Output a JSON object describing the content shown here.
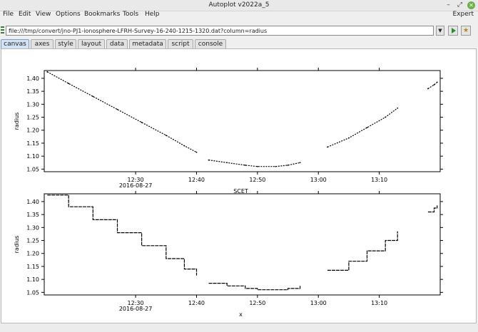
{
  "window": {
    "title": "Autoplot v2022a_5"
  },
  "menu": {
    "items": [
      "File",
      "Edit",
      "View",
      "Options",
      "Bookmarks",
      "Tools",
      "Help"
    ],
    "expert": "Expert"
  },
  "url": {
    "value": "file:///tmp/convert/jno-PJ1-ionosphere-LFRH-Survey-16-240-1215-1320.dat?column=radius"
  },
  "tabs": [
    "canvas",
    "axes",
    "style",
    "layout",
    "data",
    "metadata",
    "script",
    "console"
  ],
  "icons": {
    "minimize": "minimize-icon",
    "maximize": "maximize-icon",
    "close": "close-icon",
    "go": "play-icon",
    "bookmark": "bookmark-icon",
    "dropdown": "chevron-down-icon"
  },
  "colors": {
    "active_tab": "#d3e2f4",
    "close_button": "#6db04a",
    "go_arrow": "#2e8b2e"
  },
  "chart_data": [
    {
      "type": "scatter",
      "ylabel": "radius",
      "xlabel": "SCET",
      "date_label": "2016-08-27",
      "xticks": [
        "12:30",
        "12:40",
        "12:50",
        "13:00",
        "13:10"
      ],
      "yticks": [
        "1.05",
        "1.10",
        "1.15",
        "1.20",
        "1.25",
        "1.30",
        "1.35",
        "1.40"
      ],
      "xlim": [
        "12:15",
        "13:20"
      ],
      "ylim": [
        1.04,
        1.43
      ],
      "grid": false,
      "segments": [
        {
          "x": [
            "12:15:30",
            "12:19",
            "12:23",
            "12:27",
            "12:31",
            "12:35",
            "12:38",
            "12:40"
          ],
          "y": [
            1.425,
            1.38,
            1.33,
            1.28,
            1.23,
            1.18,
            1.14,
            1.115
          ]
        },
        {
          "x": [
            "12:42",
            "12:45",
            "12:48",
            "12:50",
            "12:53",
            "12:55",
            "12:57"
          ],
          "y": [
            1.085,
            1.075,
            1.065,
            1.06,
            1.06,
            1.065,
            1.075
          ]
        },
        {
          "x": [
            "13:01:30",
            "13:05",
            "13:08",
            "13:11",
            "13:13"
          ],
          "y": [
            1.135,
            1.17,
            1.21,
            1.25,
            1.285
          ]
        },
        {
          "x": [
            "13:18",
            "13:19",
            "13:19:30"
          ],
          "y": [
            1.36,
            1.375,
            1.385
          ]
        }
      ]
    },
    {
      "type": "line",
      "ylabel": "radius",
      "xlabel": "x",
      "date_label": "2016-08-27",
      "xticks": [
        "12:30",
        "12:40",
        "12:50",
        "13:00",
        "13:10"
      ],
      "yticks": [
        "1.05",
        "1.10",
        "1.15",
        "1.20",
        "1.25",
        "1.30",
        "1.35",
        "1.40"
      ],
      "xlim": [
        "12:15",
        "13:20"
      ],
      "ylim": [
        1.04,
        1.43
      ],
      "grid": false,
      "step": true,
      "segments": [
        {
          "x": [
            "12:15:30",
            "12:19",
            "12:23",
            "12:27",
            "12:31",
            "12:35",
            "12:38",
            "12:40"
          ],
          "y": [
            1.425,
            1.38,
            1.33,
            1.28,
            1.23,
            1.18,
            1.14,
            1.115
          ]
        },
        {
          "x": [
            "12:42",
            "12:45",
            "12:48",
            "12:50",
            "12:53",
            "12:55",
            "12:57"
          ],
          "y": [
            1.085,
            1.075,
            1.065,
            1.06,
            1.06,
            1.065,
            1.075
          ]
        },
        {
          "x": [
            "13:01:30",
            "13:05",
            "13:08",
            "13:11",
            "13:13"
          ],
          "y": [
            1.135,
            1.17,
            1.21,
            1.25,
            1.285
          ]
        },
        {
          "x": [
            "13:18",
            "13:19",
            "13:19:30"
          ],
          "y": [
            1.36,
            1.375,
            1.385
          ]
        }
      ]
    }
  ]
}
